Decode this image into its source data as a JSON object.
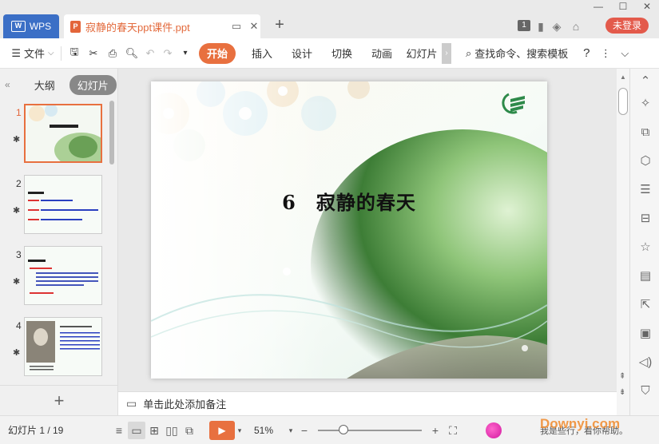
{
  "app": {
    "wps_tab_label": "WPS",
    "wps_logo": "W",
    "doc_tab_title": "寂静的春天ppt课件.ppt",
    "login_label": "未登录",
    "badge_count": "1"
  },
  "toolbar": {
    "file_label": "文件",
    "menus": [
      "开始",
      "插入",
      "设计",
      "切换",
      "动画",
      "幻灯片"
    ],
    "search_label": "查找命令、搜索模板"
  },
  "left_panel": {
    "tab_outline": "大纲",
    "tab_slides": "幻灯片",
    "slide_numbers": [
      "1",
      "2",
      "3",
      "4"
    ]
  },
  "slide": {
    "title": "6　寂静的春天"
  },
  "notes": {
    "placeholder": "单击此处添加备注"
  },
  "status": {
    "slide_indicator": "幻灯片 1 / 19",
    "zoom": "51%",
    "watermark_text": "我是些行，看你帮助。",
    "watermark_logo": "Downyi.com"
  },
  "colors": {
    "accent": "#e8703f",
    "wps_blue": "#3b6fc6",
    "login_red": "#e35a4b"
  }
}
